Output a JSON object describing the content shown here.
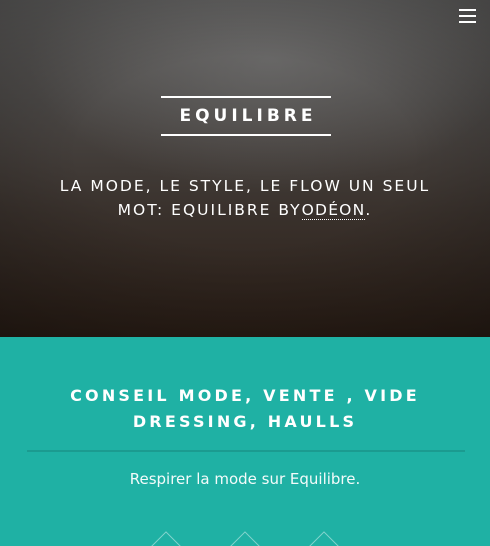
{
  "header": {
    "menu_icon": "hamburger-menu-icon"
  },
  "hero": {
    "title": "EQUILIBRE",
    "tagline_prefix": "LA MODE, LE STYLE, LE FLOW UN SEUL MOT: EQUILIBRE BY",
    "tagline_link": "ODÉON",
    "tagline_suffix": "."
  },
  "banner": {
    "heading_line1": "CONSEIL MODE, VENTE , VIDE",
    "heading_line2": "DRESSING, HAULLS",
    "subtext": "Respirer la mode sur Equilibre."
  },
  "colors": {
    "accent": "#1fb1a4",
    "hero_dark": "#2b1e16",
    "text": "#ffffff"
  }
}
